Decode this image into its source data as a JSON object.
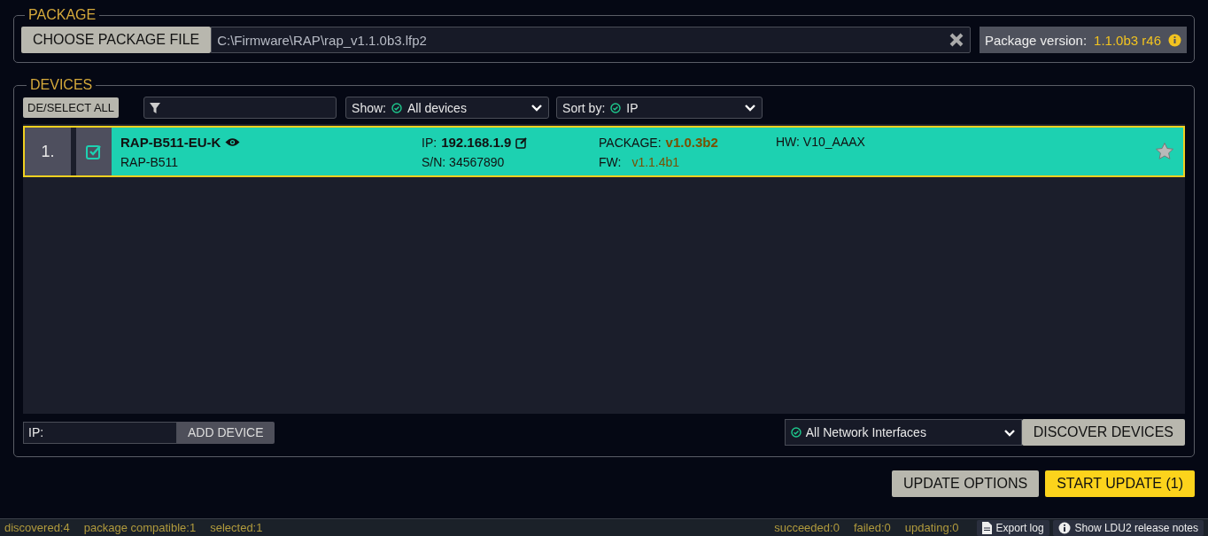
{
  "package": {
    "legend": "PACKAGE",
    "choose_button": "CHOOSE PACKAGE FILE",
    "file_path": "C:\\Firmware\\RAP\\rap_v1.1.0b3.lfp2",
    "version_label": "Package version:",
    "version_value": "1.1.0b3 r46"
  },
  "devices": {
    "legend": "DEVICES",
    "select_all": "DE/SELECT ALL",
    "show": {
      "label": "Show:",
      "value": "All devices"
    },
    "sort": {
      "label": "Sort by:",
      "value": "IP"
    },
    "rows": [
      {
        "index": "1.",
        "selected": true,
        "checked": true,
        "favorite": false,
        "name": "RAP-B511-EU-K",
        "model": "RAP-B511",
        "ip_label": "IP:",
        "ip": "192.168.1.9",
        "sn": "S/N: 34567890",
        "package_label": "PACKAGE:",
        "package_version": "v1.0.3b2",
        "fw_label": "FW:",
        "fw_version": "v1.1.4b1",
        "hw": "HW: V10_AAAX"
      }
    ],
    "ip_field": {
      "label": "IP:"
    },
    "add_button": "ADD DEVICE",
    "interface": "All Network Interfaces",
    "discover_button": "DISCOVER DEVICES"
  },
  "actions": [
    {
      "label": "UPDATE OPTIONS",
      "kind": "secondary"
    },
    {
      "label": "START UPDATE (1)",
      "kind": "primary"
    }
  ],
  "status_bar": {
    "left": [
      "discovered:4",
      "package compatible:1",
      "selected:1"
    ],
    "right": [
      "succeeded:0",
      "failed:0",
      "updating:0"
    ],
    "export": "Export log",
    "notes": "Show LDU2 release notes"
  }
}
